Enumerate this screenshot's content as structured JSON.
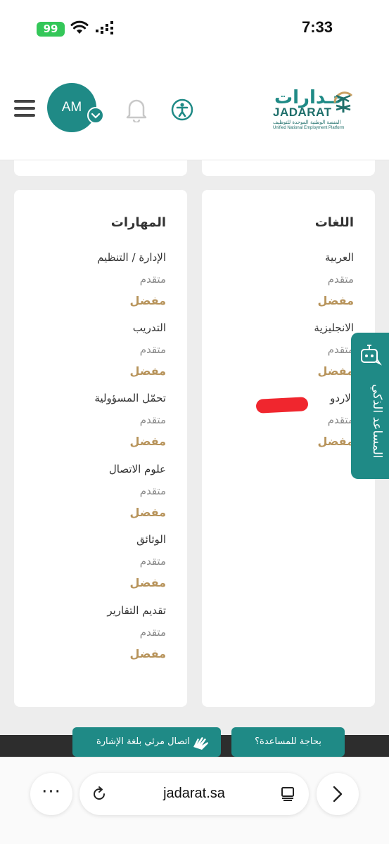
{
  "status_bar": {
    "time": "7:33",
    "battery": "99"
  },
  "header": {
    "avatar_initials": "AM",
    "logo": {
      "arabic": "جـدارات",
      "english": "JADARAT",
      "subtitle_ar": "المنصة الوطنية الموحدة للتوظيف",
      "subtitle_en": "Unified National Employment Platform"
    }
  },
  "skills": {
    "title": "المهارات",
    "items": [
      {
        "name": "الإدارة / التنظيم",
        "level": "متقدم",
        "preference": "مفضل"
      },
      {
        "name": "التدريب",
        "level": "متقدم",
        "preference": "مفضل"
      },
      {
        "name": "تحمّل المسؤولية",
        "level": "متقدم",
        "preference": "مفضل"
      },
      {
        "name": "علوم الاتصال",
        "level": "متقدم",
        "preference": "مفضل"
      },
      {
        "name": "الوثائق",
        "level": "متقدم",
        "preference": "مفضل"
      },
      {
        "name": "تقديم التقارير",
        "level": "متقدم",
        "preference": "مفضل"
      }
    ]
  },
  "languages": {
    "title": "اللغات",
    "items": [
      {
        "name": "العربية",
        "level": "متقدم",
        "preference": "مفضل"
      },
      {
        "name": "الانجليزية",
        "level": "متقدم",
        "preference": "مفضل"
      },
      {
        "name": "الاردو",
        "level": "متقدم",
        "preference": "مفضل"
      }
    ]
  },
  "assistant": {
    "label": "المساعد الذكي"
  },
  "footer": {
    "help_label": "بحاجة للمساعدة؟",
    "sign_language_label": "اتصال مرئي بلغة الإشارة"
  },
  "browser": {
    "url": "jadarat.sa",
    "more": "···"
  },
  "colors": {
    "brand": "#1f8a86",
    "preferred": "#b7935a",
    "redaction": "#f0262e"
  }
}
